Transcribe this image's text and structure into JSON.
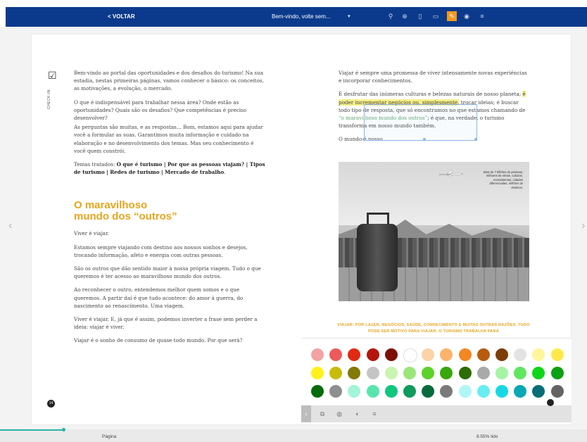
{
  "nav": {
    "back": "< VOLTAR",
    "title": "Bem-vindo, volte sem...",
    "dropdown": "▾",
    "tools": [
      {
        "name": "search-icon",
        "glyph": "⚲"
      },
      {
        "name": "zoom-icon",
        "glyph": "⊕"
      },
      {
        "name": "bookmark-icon",
        "glyph": "▯"
      },
      {
        "name": "comment-icon",
        "glyph": "▭"
      },
      {
        "name": "highlighter-icon",
        "glyph": "✎"
      },
      {
        "name": "eye-icon",
        "glyph": "◉"
      },
      {
        "name": "menu-icon",
        "glyph": "≡"
      }
    ]
  },
  "checkin": {
    "label": "CHECK-IN"
  },
  "left": {
    "p1": "Bem-vindo ao portal das oportunidades e dos desafios do turismo! Na sua estadia, nestas primeiras páginas, vamos conhecer o básico: os conceitos, as motivações, a evolução, o mercado.",
    "p2": "O que é indispensável para trabalhar nessa área? Onde estão as oportunidades? Quais são os desafios? Que competências é preciso desenvolver?",
    "p3": "As perguntas são muitas, e as respostas... Bom, estamos aqui para ajudar você a formular as suas. Garantimos muita informação e cuidado na elaboração e no desenvolvimento dos temas. Mas seu conhecimento é você quem constrói.",
    "p4_prefix": "Temas tratados: ",
    "p4_bold": "O que é turismo | Por que as pessoas viajam? | Tipos de turismo | Redes de turismo | Mercado de trabalho",
    "p4_suffix": ".",
    "heading_line1": "O maravilhoso",
    "heading_line2": "mundo dos “outros”",
    "p5": "Viver é viajar.",
    "p6": "Estamos sempre viajando com destino aos nossos sonhos e desejos, trocando informação, afeto e energia com outras pessoas.",
    "p7": "São os outros que dão sentido maior à nossa própria viagem. Tudo o que queremos é ter acesso ao maravilhoso mundo dos outros.",
    "p8": "Ao reconhecer o outro, entendemos melhor quem somos e o que queremos. A partir daí é que tudo acontece: do amor à guerra, do nascimento ao renascimento. Uma viagem.",
    "p9": "Viver é viajar. E, já que é assim, podemos inverter a frase sem perder a ideia: viajar é viver.",
    "p10": "Viajar é o sonho de consumo de quase todo mundo. Por que será?"
  },
  "right": {
    "p1": "Viajar é sempre uma promessa de viver intensamente novas experiências e incorporar conhecimentos.",
    "p2_a": "É desfrutar das inúmeras culturas e belezas naturais de nosso planeta; ",
    "p2_hl": "é poder incrementar negócios ou, simplesmente,",
    "p2_b": " trocar ideias; é buscar todo tipo de resposta, que só encontramos no que estamos chamando de ",
    "p2_green": "“o maravilhoso mundo dos outros”",
    "p2_c": "; é que, na verdade, o turismo transforma em nosso mundo também.",
    "p3": "O mundo é nosso."
  },
  "figure": {
    "caption": "Mais de 7 bilhões de pessoas, milhares de etnias, culturas, ecossistemas, cidades diferenciadas, milhões de destinos."
  },
  "figure_caption": "VIAJAR: POR LAZER, NEGÓCIOS, SAÚDE, CONHECIMENTO E MUITAS OUTRAS RAZÕES. TUDO PODE SER MOTIVO PARA VIAJAR. O TURISMO TRABALHA PARA",
  "palette": {
    "colors": [
      "#f4a3a3",
      "#ee5a5a",
      "#e02a14",
      "#b4160c",
      "#7f0f06",
      "#ffffff",
      "#fcd2a6",
      "#fbb36b",
      "#f48721",
      "#b75c0d",
      "#7b3e05",
      "#e3e3e3",
      "#fff59b",
      "#ffe94a",
      "#fff21a",
      "#c8bc09",
      "#837907",
      "#c5c5c5",
      "#c9f4b1",
      "#9ae67a",
      "#5dd22b",
      "#38a70d",
      "#2e6c06",
      "#a9a9a9",
      "#a6f4a3",
      "#61e660",
      "#10d61a",
      "#0aa112",
      "#086b0b",
      "#8f8f8f",
      "#a2f5d6",
      "#59e4ae",
      "#10c77f",
      "#0e9b5d",
      "#076b3c",
      "#7a7a7a",
      "#b0f6f6",
      "#68edf0",
      "#16d8e4",
      "#0ba7b4",
      "#076e78",
      "#646464"
    ]
  },
  "palette_tools": [
    {
      "name": "pages-icon",
      "glyph": "⧉"
    },
    {
      "name": "paint-bucket-icon",
      "glyph": "◍"
    },
    {
      "name": "opacity-icon",
      "glyph": "◐"
    },
    {
      "name": "lines-icon",
      "glyph": "≡"
    }
  ],
  "page_number": "14",
  "bottom": {
    "page_label": "Página",
    "read_label": "8.55% lido"
  }
}
